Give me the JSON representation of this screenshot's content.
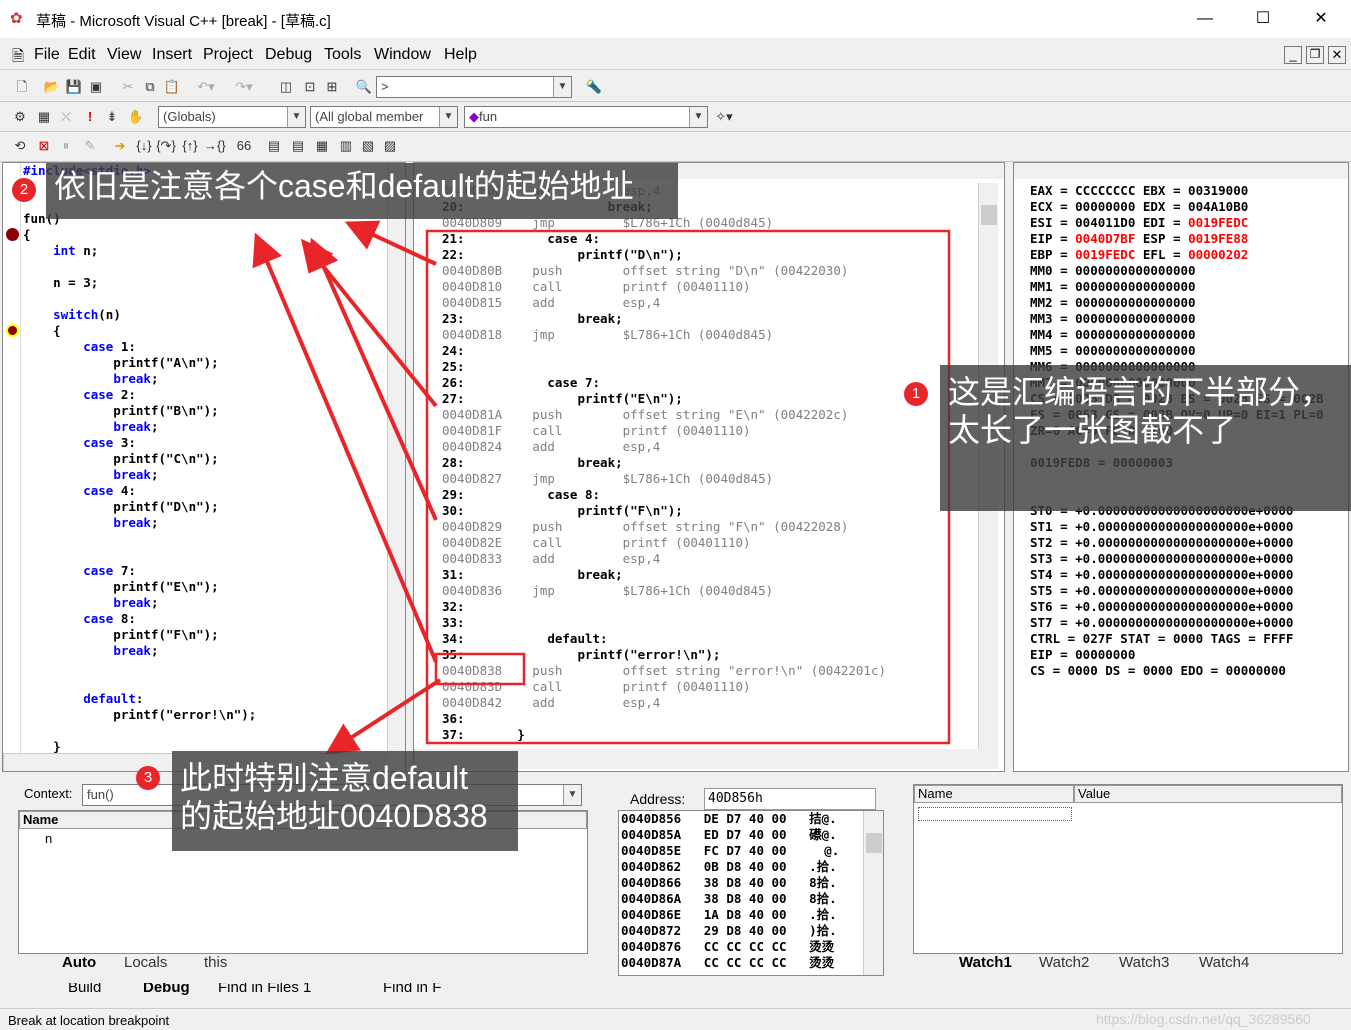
{
  "window": {
    "title": "草稿 - Microsoft Visual C++ [break] - [草稿.c]",
    "minimize": "—",
    "maximize": "☐",
    "close": "✕"
  },
  "menu": [
    "File",
    "Edit",
    "View",
    "Insert",
    "Project",
    "Debug",
    "Tools",
    "Window",
    "Help"
  ],
  "toolbar": {
    "find_combo": ">",
    "globals": "(Globals)",
    "members": "(All global member",
    "function": "fun"
  },
  "source": {
    "lines": [
      "#include<stdio.h>",
      "",
      "",
      "fun()",
      "{",
      "    int n;",
      "",
      "    n = 3;",
      "",
      "    switch(n)",
      "    {",
      "        case 1:",
      "            printf(\"A\\n\");",
      "            break;",
      "        case 2:",
      "            printf(\"B\\n\");",
      "            break;",
      "        case 3:",
      "            printf(\"C\\n\");",
      "            break;",
      "        case 4:",
      "            printf(\"D\\n\");",
      "            break;",
      "",
      "",
      "        case 7:",
      "            printf(\"E\\n\");",
      "            break;",
      "        case 8:",
      "            printf(\"F\\n\");",
      "            break;",
      "",
      "",
      "        default:",
      "            printf(\"error!\\n\");",
      "",
      "    }"
    ]
  },
  "disasm": {
    "lines": [
      {
        "t": "0040D806    add         esp,4",
        "g": true
      },
      {
        "t": "20:                   break;",
        "g": false
      },
      {
        "t": "0040D809    jmp         $L786+1Ch (0040d845)",
        "g": true
      },
      {
        "t": "21:           case 4:",
        "g": false
      },
      {
        "t": "22:               printf(\"D\\n\");",
        "g": false
      },
      {
        "t": "0040D80B    push        offset string \"D\\n\" (00422030)",
        "g": true
      },
      {
        "t": "0040D810    call        printf (00401110)",
        "g": true
      },
      {
        "t": "0040D815    add         esp,4",
        "g": true
      },
      {
        "t": "23:               break;",
        "g": false
      },
      {
        "t": "0040D818    jmp         $L786+1Ch (0040d845)",
        "g": true
      },
      {
        "t": "24:",
        "g": false
      },
      {
        "t": "25:",
        "g": false
      },
      {
        "t": "26:           case 7:",
        "g": false
      },
      {
        "t": "27:               printf(\"E\\n\");",
        "g": false
      },
      {
        "t": "0040D81A    push        offset string \"E\\n\" (0042202c)",
        "g": true
      },
      {
        "t": "0040D81F    call        printf (00401110)",
        "g": true
      },
      {
        "t": "0040D824    add         esp,4",
        "g": true
      },
      {
        "t": "28:               break;",
        "g": false
      },
      {
        "t": "0040D827    jmp         $L786+1Ch (0040d845)",
        "g": true
      },
      {
        "t": "29:           case 8:",
        "g": false
      },
      {
        "t": "30:               printf(\"F\\n\");",
        "g": false
      },
      {
        "t": "0040D829    push        offset string \"F\\n\" (00422028)",
        "g": true
      },
      {
        "t": "0040D82E    call        printf (00401110)",
        "g": true
      },
      {
        "t": "0040D833    add         esp,4",
        "g": true
      },
      {
        "t": "31:               break;",
        "g": false
      },
      {
        "t": "0040D836    jmp         $L786+1Ch (0040d845)",
        "g": true
      },
      {
        "t": "32:",
        "g": false
      },
      {
        "t": "33:",
        "g": false
      },
      {
        "t": "34:           default:",
        "g": false
      },
      {
        "t": "35:               printf(\"error!\\n\");",
        "g": false
      },
      {
        "t": "0040D838    push        offset string \"error!\\n\" (0042201c)",
        "g": true
      },
      {
        "t": "0040D83D    call        printf (00401110)",
        "g": true
      },
      {
        "t": "0040D842    add         esp,4",
        "g": true
      },
      {
        "t": "36:",
        "g": false
      },
      {
        "t": "37:       }",
        "g": false
      }
    ]
  },
  "registers": [
    [
      [
        "EAX = CCCCCCCC EBX = 00319000",
        false
      ]
    ],
    [
      [
        "ECX = 00000000 EDX = 004A10B0",
        false
      ]
    ],
    [
      [
        "ESI = 004011D0 EDI = ",
        false
      ],
      [
        "0019FEDC",
        true
      ]
    ],
    [
      [
        "EIP = ",
        false
      ],
      [
        "0040D7BF",
        true
      ],
      [
        " ESP = ",
        false
      ],
      [
        "0019FE88",
        true
      ]
    ],
    [
      [
        "EBP = ",
        false
      ],
      [
        "0019FEDC",
        true
      ],
      [
        " EFL = ",
        false
      ],
      [
        "00000202",
        true
      ]
    ],
    [
      [
        "MM0 = 0000000000000000",
        false
      ]
    ],
    [
      [
        "MM1 = 0000000000000000",
        false
      ]
    ],
    [
      [
        "MM2 = 0000000000000000",
        false
      ]
    ],
    [
      [
        "MM3 = 0000000000000000",
        false
      ]
    ],
    [
      [
        "MM4 = 0000000000000000",
        false
      ]
    ],
    [
      [
        "MM5 = 0000000000000000",
        false
      ]
    ],
    [
      [
        "MM6 = 0000000000000000",
        false
      ]
    ],
    [
      [
        "MM7 = 0000000000000000",
        false
      ]
    ],
    [
      [
        "CS = 0023 DS = 0023 ES = 0023 SS = 002B",
        false
      ]
    ],
    [
      [
        "FS = 0053 GS = 002B OV=0 UP=0 EI=1 PL=0",
        false
      ]
    ],
    [
      [
        "ZR=0 AC=0 PE=0 CY=0",
        false
      ]
    ],
    [
      [
        "",
        false
      ]
    ],
    [
      [
        "0019FED8 = 00000003",
        false
      ]
    ],
    [
      [
        "",
        false
      ]
    ],
    [
      [
        "",
        false
      ]
    ],
    [
      [
        "ST0 = +0.00000000000000000000e+0000",
        false
      ]
    ],
    [
      [
        "ST1 = +0.00000000000000000000e+0000",
        false
      ]
    ],
    [
      [
        "ST2 = +0.00000000000000000000e+0000",
        false
      ]
    ],
    [
      [
        "ST3 = +0.00000000000000000000e+0000",
        false
      ]
    ],
    [
      [
        "ST4 = +0.00000000000000000000e+0000",
        false
      ]
    ],
    [
      [
        "ST5 = +0.00000000000000000000e+0000",
        false
      ]
    ],
    [
      [
        "ST6 = +0.00000000000000000000e+0000",
        false
      ]
    ],
    [
      [
        "ST7 = +0.00000000000000000000e+0000",
        false
      ]
    ],
    [
      [
        "CTRL = 027F STAT = 0000 TAGS = FFFF",
        false
      ]
    ],
    [
      [
        "EIP = 00000000",
        false
      ]
    ],
    [
      [
        "CS = 0000 DS = 0000 EDO = 00000000",
        false
      ]
    ]
  ],
  "variables": {
    "context_label": "Context:",
    "context_value": "fun()",
    "col_name": "Name",
    "rows": [
      "n"
    ],
    "tabs": [
      "Auto",
      "Locals",
      "this"
    ]
  },
  "memory": {
    "address_label": "Address:",
    "address_value": "40D856h",
    "rows": [
      "0040D856   DE D7 40 00   拮@.",
      "0040D85A   ED D7 40 00   礤@.",
      "0040D85E   FC D7 40 00     @.",
      "0040D862   0B D8 40 00   .拾.",
      "0040D866   38 D8 40 00   8拾.",
      "0040D86A   38 D8 40 00   8拾.",
      "0040D86E   1A D8 40 00   .拾.",
      "0040D872   29 D8 40 00   )拾.",
      "0040D876   CC CC CC CC   烫烫",
      "0040D87A   CC CC CC CC   烫烫"
    ]
  },
  "watch": {
    "col_name": "Name",
    "col_value": "Value",
    "tabs": [
      "Watch1",
      "Watch2",
      "Watch3",
      "Watch4"
    ]
  },
  "output_tabs": [
    "Build",
    "Debug",
    "Find in Files 1",
    "Find in F"
  ],
  "status": "Break at location breakpoint",
  "watermark": "https://blog.csdn.net/qq_36289560",
  "annotations": [
    {
      "num": "2",
      "text": "依旧是注意各个case和default的起始地址"
    },
    {
      "num": "1",
      "text": "这是汇编语言的下半部分，\n太长了一张图截不了"
    },
    {
      "num": "3",
      "text": "此时特别注意default\n的起始地址0040D838"
    }
  ],
  "colors": {
    "annotation_red": "#e8262a",
    "register_changed": "#ff0000",
    "keyword": "#0000ff"
  }
}
